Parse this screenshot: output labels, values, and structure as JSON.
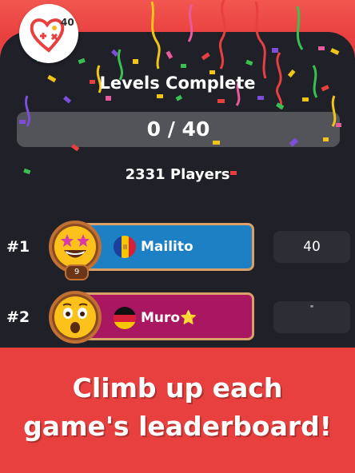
{
  "app": {
    "logo_number": "40"
  },
  "header": {
    "title": "Levels Complete"
  },
  "progress": {
    "text": "0 / 40",
    "completed": 0,
    "total": 40
  },
  "players": {
    "count_label": "2331 Players"
  },
  "leaderboard": {
    "rows": [
      {
        "rank": "#1",
        "name": "Mailito",
        "score": "40",
        "level": "9",
        "flag": "andorra-flag-icon",
        "bar_color": "#1d7fc4"
      },
      {
        "rank": "#2",
        "name": "Muro",
        "name_suffix": "⭐",
        "score": "\"",
        "flag": "germany-flag-icon",
        "bar_color": "#a8175f"
      }
    ]
  },
  "promo": {
    "line1": "Climb up each",
    "line2": "game's leaderboard!"
  },
  "colors": {
    "brand_red": "#e8403f",
    "panel": "#1f2028",
    "blue_bar": "#1d7fc4",
    "magenta_bar": "#a8175f"
  }
}
